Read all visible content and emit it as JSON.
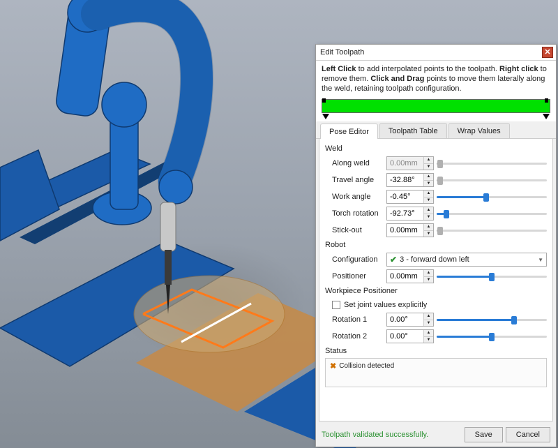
{
  "dialog": {
    "title": "Edit Toolpath",
    "instructions_parts": {
      "b1": "Left Click",
      "t1": " to add interpolated points to the toolpath. ",
      "b2": "Right click",
      "t2": " to remove them. ",
      "b3": "Click and Drag",
      "t3": " points to move them laterally along the weld, retaining toolpath configuration."
    },
    "tabs": {
      "pose": "Pose Editor",
      "table": "Toolpath Table",
      "wrap": "Wrap Values"
    },
    "footer": {
      "validated": "Toolpath validated successfully.",
      "save": "Save",
      "cancel": "Cancel"
    }
  },
  "pose": {
    "weld": {
      "title": "Weld",
      "along_label": "Along weld",
      "along_value": "0.00mm",
      "travel_label": "Travel angle",
      "travel_value": "-32.88°",
      "work_label": "Work angle",
      "work_value": "-0.45°",
      "torch_label": "Torch rotation",
      "torch_value": "-92.73°",
      "stick_label": "Stick-out",
      "stick_value": "0.00mm"
    },
    "robot": {
      "title": "Robot",
      "config_label": "Configuration",
      "config_value": "3 - forward down left",
      "positioner_label": "Positioner",
      "positioner_value": "0.00mm"
    },
    "wp": {
      "title": "Workpiece Positioner",
      "explicit_label": "Set joint values explicitly",
      "rot1_label": "Rotation 1",
      "rot1_value": "0.00°",
      "rot2_label": "Rotation 2",
      "rot2_value": "0.00°"
    },
    "status": {
      "title": "Status",
      "collision": "Collision detected"
    }
  },
  "sliders": {
    "along": 3,
    "travel": 3,
    "work": 45,
    "torch": 9,
    "stick": 3,
    "positioner": 50,
    "rot1": 70,
    "rot2": 50
  }
}
